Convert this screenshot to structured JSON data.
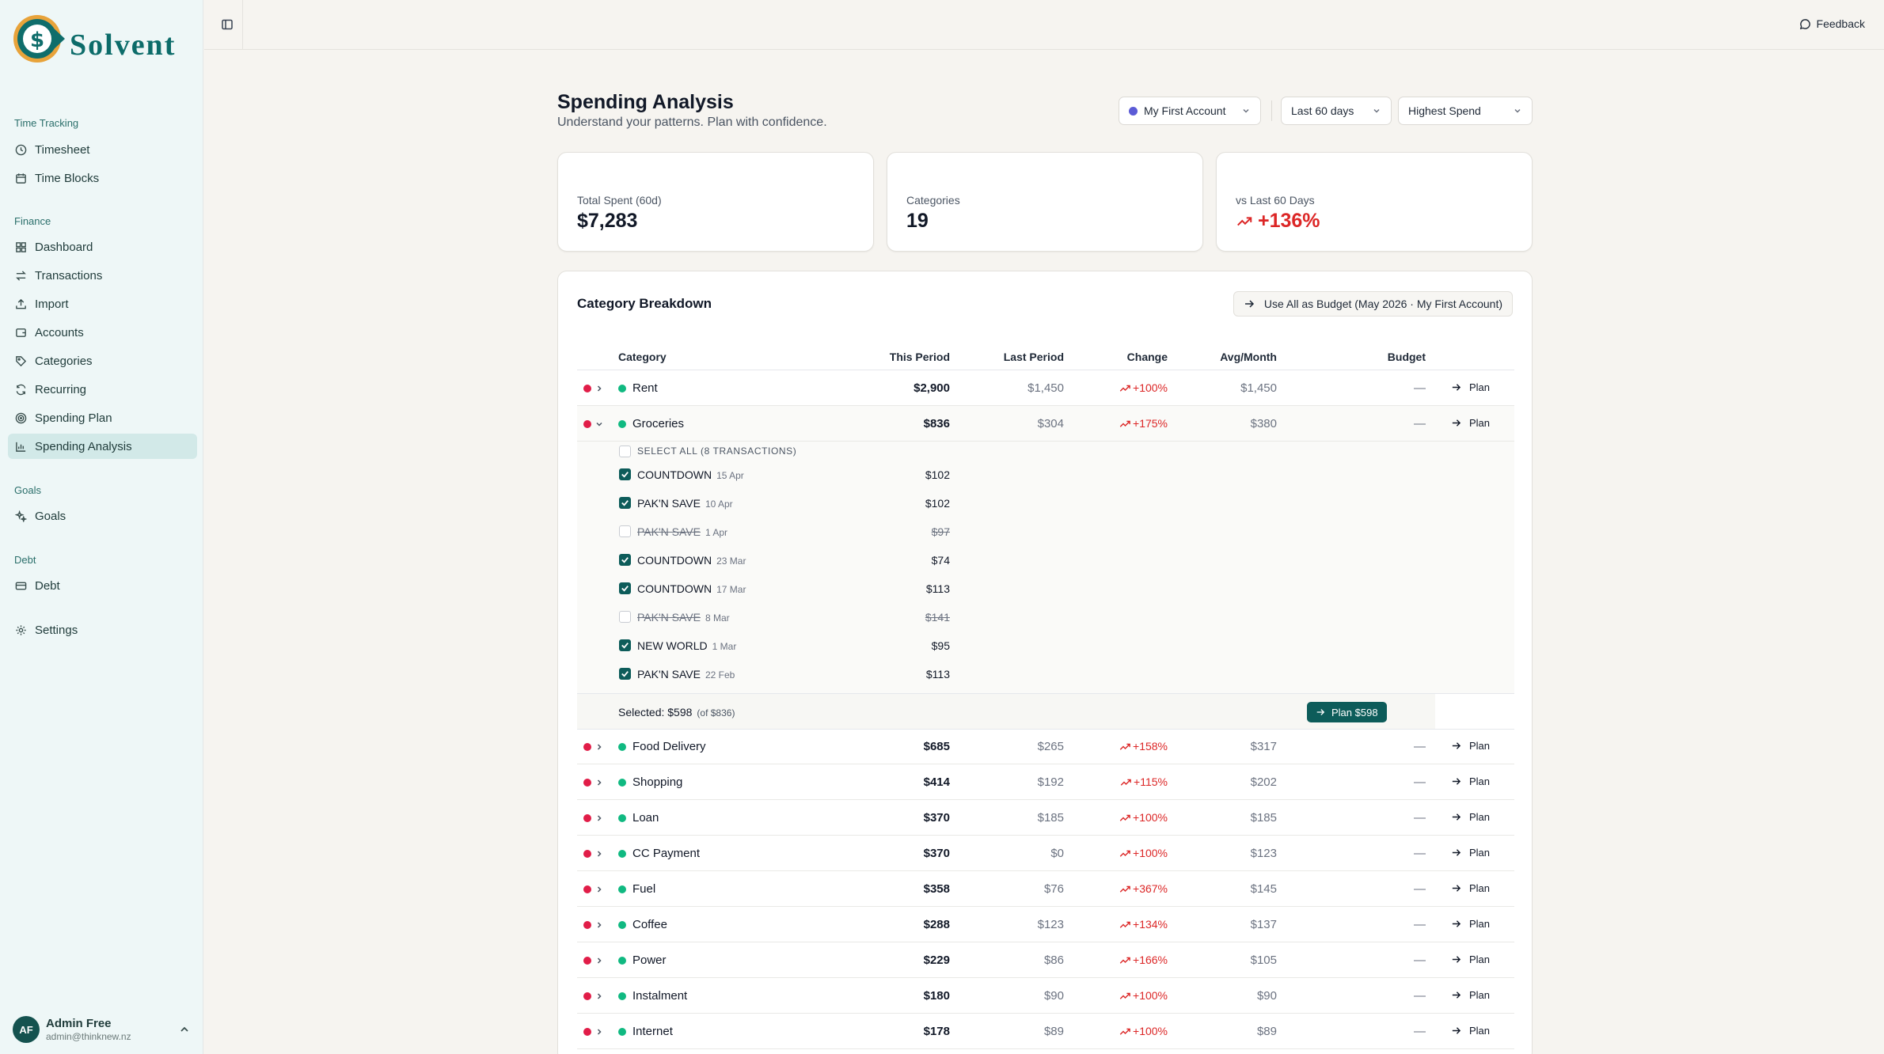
{
  "brand": {
    "name": "Solvent"
  },
  "sidebar": {
    "sections": [
      {
        "label": "Time Tracking",
        "items": [
          {
            "label": "Timesheet",
            "icon": "clock-icon"
          },
          {
            "label": "Time Blocks",
            "icon": "calendar-icon"
          }
        ]
      },
      {
        "label": "Finance",
        "items": [
          {
            "label": "Dashboard",
            "icon": "grid-icon"
          },
          {
            "label": "Transactions",
            "icon": "arrows-icon"
          },
          {
            "label": "Import",
            "icon": "upload-icon"
          },
          {
            "label": "Accounts",
            "icon": "wallet-icon"
          },
          {
            "label": "Categories",
            "icon": "tag-icon"
          },
          {
            "label": "Recurring",
            "icon": "refresh-icon"
          },
          {
            "label": "Spending Plan",
            "icon": "target-icon"
          },
          {
            "label": "Spending Analysis",
            "icon": "bar-chart-icon",
            "active": true
          }
        ]
      },
      {
        "label": "Goals",
        "items": [
          {
            "label": "Goals",
            "icon": "sparkle-icon"
          }
        ]
      },
      {
        "label": "Debt",
        "items": [
          {
            "label": "Debt",
            "icon": "card-icon"
          }
        ]
      }
    ],
    "settings_label": "Settings",
    "user": {
      "initials": "AF",
      "name": "Admin Free",
      "email": "admin@thinknew.nz"
    }
  },
  "topbar": {
    "feedback_label": "Feedback"
  },
  "page": {
    "title": "Spending Analysis",
    "subtitle": "Understand your patterns. Plan with confidence.",
    "filters": {
      "account": "My First Account",
      "period": "Last 60 days",
      "sort": "Highest Spend"
    },
    "accent_color": "#0d5c5a"
  },
  "cards": [
    {
      "label": "Total Spent (60d)",
      "value": "$7,283"
    },
    {
      "label": "Categories",
      "value": "19"
    },
    {
      "label": "vs Last 60 Days",
      "value": "+136%"
    }
  ],
  "breakdown": {
    "title": "Category Breakdown",
    "use_all_label": "Use All as Budget (May 2026 · My First Account)",
    "columns": {
      "category": "Category",
      "this_period": "This Period",
      "last_period": "Last Period",
      "change": "Change",
      "avg": "Avg/Month",
      "budget": "Budget"
    },
    "plan_label": "Plan",
    "rows": [
      {
        "name": "Rent",
        "this": "$2,900",
        "last": "$1,450",
        "change": "+100%",
        "avg": "$1,450",
        "budget": "—"
      },
      {
        "name": "Groceries",
        "this": "$836",
        "last": "$304",
        "change": "+175%",
        "avg": "$380",
        "budget": "—",
        "expanded": true
      },
      {
        "name": "Food Delivery",
        "this": "$685",
        "last": "$265",
        "change": "+158%",
        "avg": "$317",
        "budget": "—"
      },
      {
        "name": "Shopping",
        "this": "$414",
        "last": "$192",
        "change": "+115%",
        "avg": "$202",
        "budget": "—"
      },
      {
        "name": "Loan",
        "this": "$370",
        "last": "$185",
        "change": "+100%",
        "avg": "$185",
        "budget": "—"
      },
      {
        "name": "CC Payment",
        "this": "$370",
        "last": "$0",
        "change": "+100%",
        "avg": "$123",
        "budget": "—"
      },
      {
        "name": "Fuel",
        "this": "$358",
        "last": "$76",
        "change": "+367%",
        "avg": "$145",
        "budget": "—"
      },
      {
        "name": "Coffee",
        "this": "$288",
        "last": "$123",
        "change": "+134%",
        "avg": "$137",
        "budget": "—"
      },
      {
        "name": "Power",
        "this": "$229",
        "last": "$86",
        "change": "+166%",
        "avg": "$105",
        "budget": "—"
      },
      {
        "name": "Instalment",
        "this": "$180",
        "last": "$90",
        "change": "+100%",
        "avg": "$90",
        "budget": "—"
      },
      {
        "name": "Internet",
        "this": "$178",
        "last": "$89",
        "change": "+100%",
        "avg": "$89",
        "budget": "—"
      }
    ],
    "groceries_detail": {
      "select_all": "SELECT ALL (8 TRANSACTIONS)",
      "transactions": [
        {
          "name": "COUNTDOWN",
          "date": "15 Apr",
          "amount": "$102",
          "checked": true
        },
        {
          "name": "PAK'N SAVE",
          "date": "10 Apr",
          "amount": "$102",
          "checked": true
        },
        {
          "name": "PAK'N SAVE",
          "date": "1 Apr",
          "amount": "$97",
          "checked": false
        },
        {
          "name": "COUNTDOWN",
          "date": "23 Mar",
          "amount": "$74",
          "checked": true
        },
        {
          "name": "COUNTDOWN",
          "date": "17 Mar",
          "amount": "$113",
          "checked": true
        },
        {
          "name": "PAK'N SAVE",
          "date": "8 Mar",
          "amount": "$141",
          "checked": false
        },
        {
          "name": "NEW WORLD",
          "date": "1 Mar",
          "amount": "$95",
          "checked": true
        },
        {
          "name": "PAK'N SAVE",
          "date": "22 Feb",
          "amount": "$113",
          "checked": true
        }
      ],
      "selected_label": "Selected: $598",
      "of_label": "(of $836)",
      "plan_button": "Plan $598"
    }
  }
}
